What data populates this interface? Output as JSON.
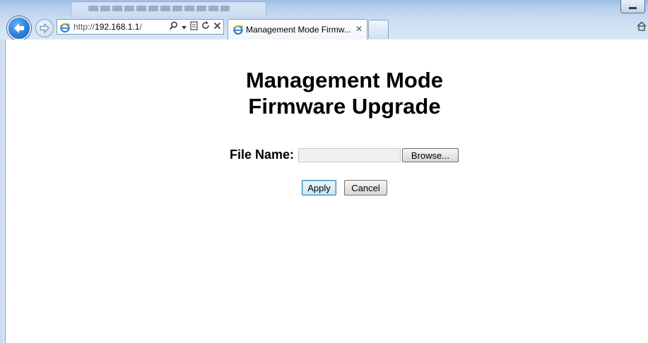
{
  "browser": {
    "url_protocol": "http://",
    "url_host": "192.168.1.1",
    "url_path": "/",
    "tab_title": "Management Mode Firmw...",
    "tab_close": "✕"
  },
  "page": {
    "title_line1": "Management Mode",
    "title_line2": "Firmware Upgrade",
    "file_label": "File Name:",
    "file_value": "",
    "browse_label": "Browse...",
    "apply_label": "Apply",
    "cancel_label": "Cancel"
  },
  "icons": {
    "back": "back-arrow-icon",
    "forward": "forward-arrow-icon",
    "ie": "ie-icon",
    "search": "search-icon",
    "compat": "compatibility-view-icon",
    "refresh": "refresh-icon",
    "stop": "stop-icon",
    "home": "home-icon"
  },
  "colors": {
    "chrome": "#b9d1ee",
    "back_button": "#2d7ed8",
    "apply_border": "#3c7fb1"
  }
}
